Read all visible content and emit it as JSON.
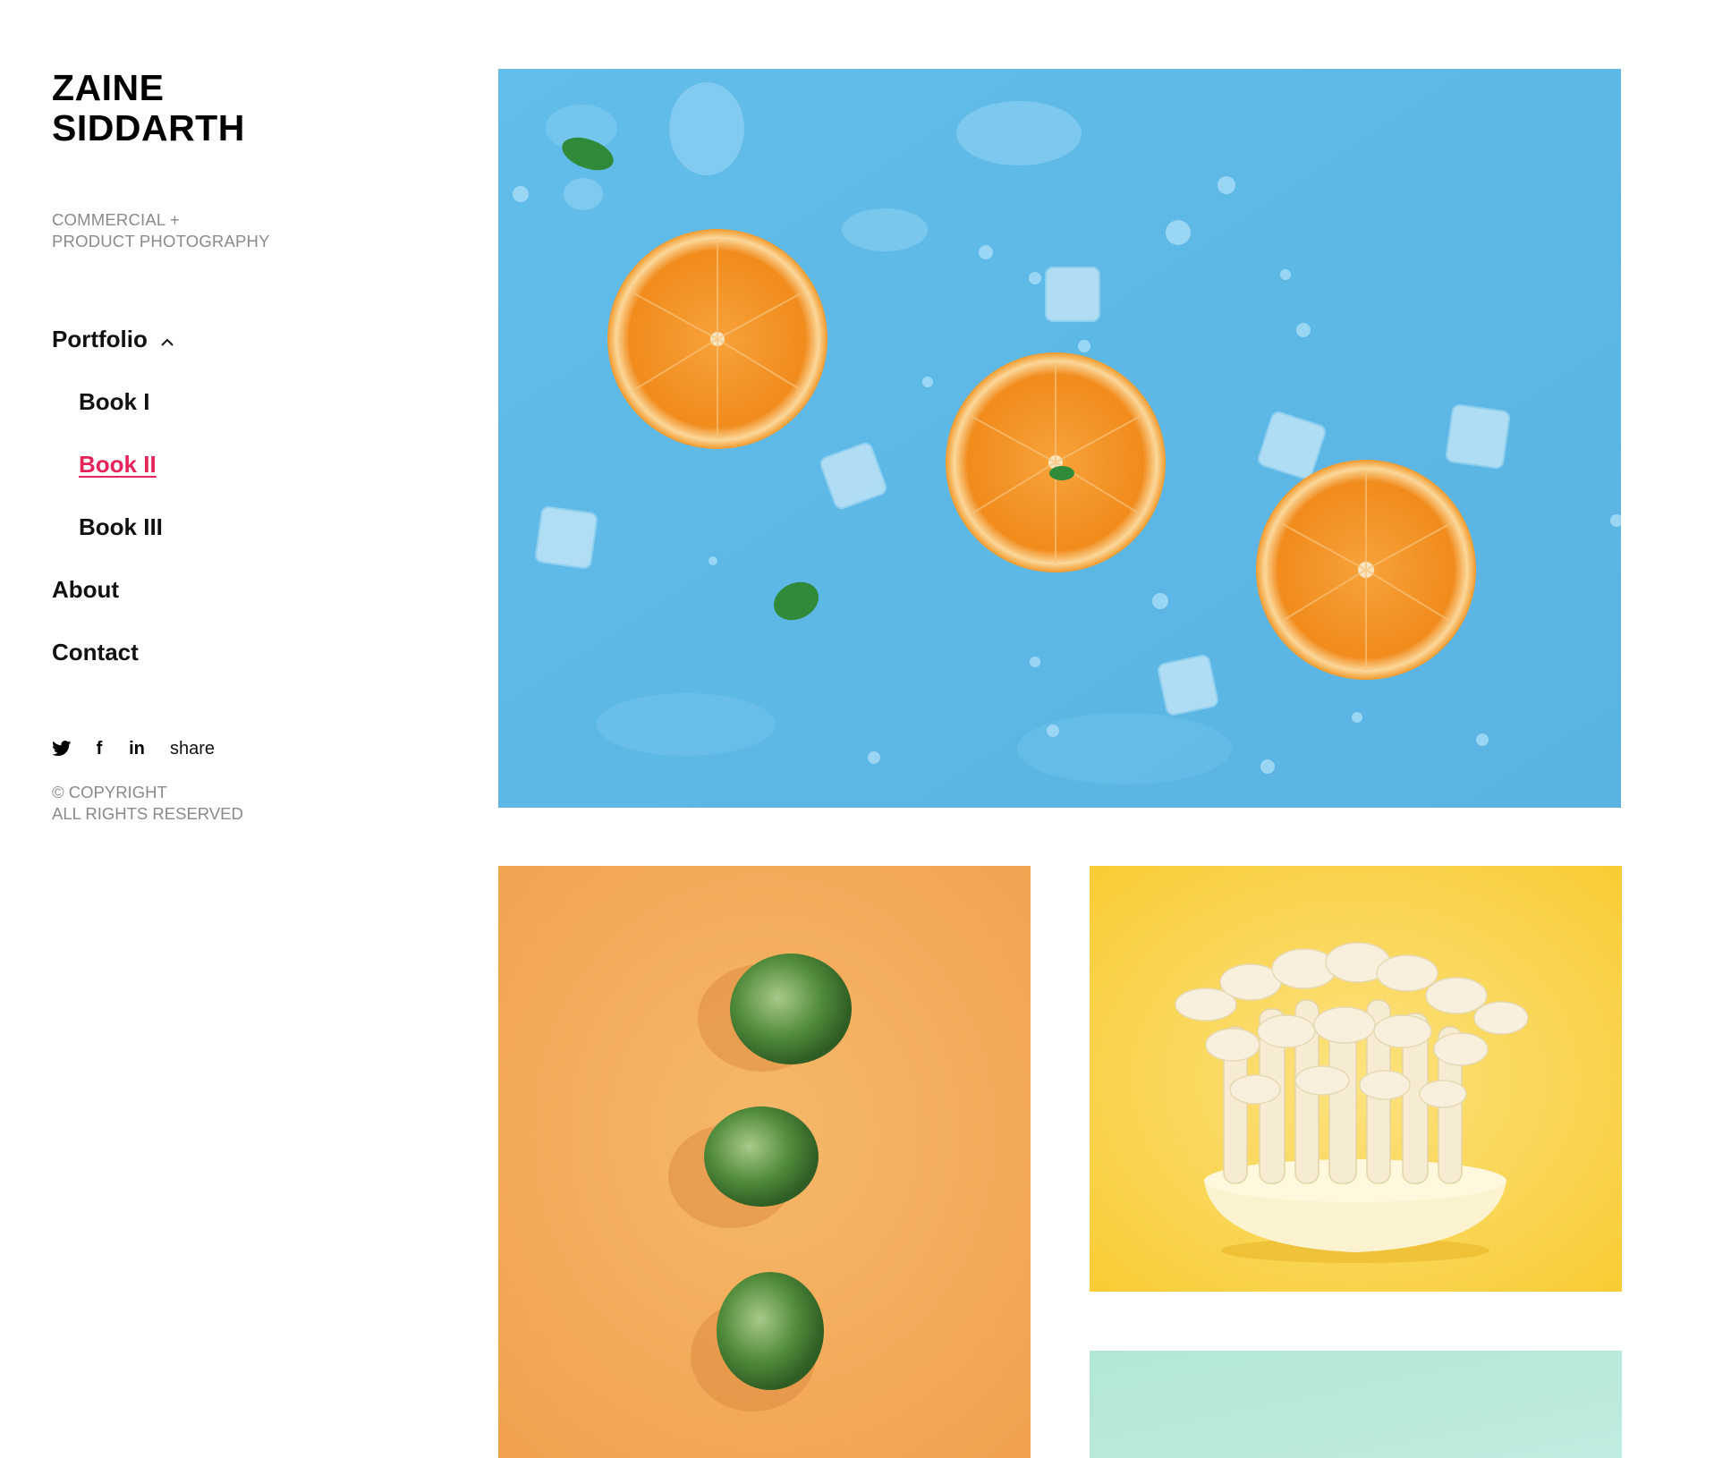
{
  "brand": {
    "line1": "ZAINE",
    "line2": "SIDDARTH"
  },
  "tagline": {
    "line1": "COMMERCIAL +",
    "line2": "PRODUCT PHOTOGRAPHY"
  },
  "nav": {
    "portfolio": "Portfolio",
    "book1": "Book I",
    "book2": "Book II",
    "book3": "Book III",
    "about": "About",
    "contact": "Contact"
  },
  "social": {
    "twitter_icon": "twitter-icon",
    "facebook_icon": "facebook-icon",
    "linkedin_icon": "linkedin-icon",
    "facebook_glyph": "f",
    "linkedin_glyph": "in",
    "share": "share"
  },
  "copyright": {
    "line1": "© COPYRIGHT",
    "line2": "ALL RIGHTS RESERVED"
  },
  "colors": {
    "accent": "#e6245a",
    "blue_photo": "#5db8e4",
    "orange_photo": "#f2a24e",
    "yellow_photo": "#f9d23c",
    "mint_photo": "#b4e8d8"
  },
  "gallery": {
    "photos": [
      "orange slices on blue with ice cubes",
      "brussels sprouts on orange",
      "mushrooms in bowl on yellow",
      "mint background"
    ]
  }
}
